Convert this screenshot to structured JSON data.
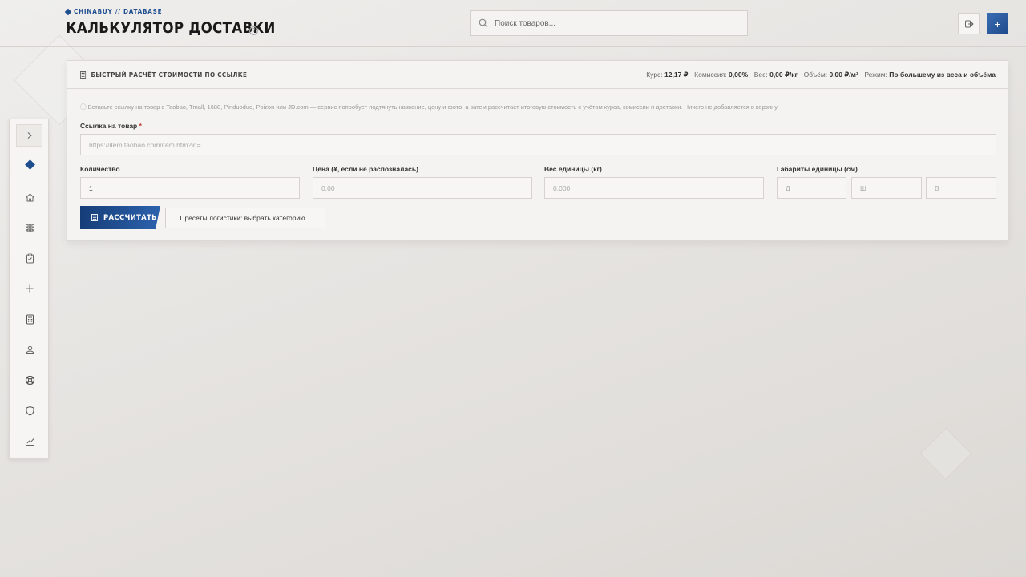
{
  "header": {
    "brand": "CHINABUY // DATABASE",
    "title": "КАЛЬКУЛЯТОР ДОСТАВКИ",
    "help_icon": "?",
    "search_placeholder": "Поиск товаров...",
    "plus_label": "+"
  },
  "sidebar": {
    "items": [
      "chevron-right-icon",
      "diamond-icon",
      "home-icon",
      "grid-icon",
      "clipboard-check-icon",
      "plus-icon",
      "calculator-icon",
      "user-icon",
      "lifebuoy-icon",
      "shield-icon",
      "chart-line-icon"
    ]
  },
  "card": {
    "title": "БЫСТРЫЙ РАСЧЁТ СТОИМОСТИ ПО ССЫЛКЕ",
    "stats": {
      "rate_label": "Курс:",
      "rate_value": "12,17 ₽",
      "commission_label": "· Комиссия:",
      "commission_value": "0,00%",
      "weight_label": "· Вес:",
      "weight_value": "0,00 ₽/кг",
      "volume_label": "· Объём:",
      "volume_value": "0,00 ₽/м³",
      "mode_label": "· Режим:",
      "mode_value": "По большему из веса и объёма"
    },
    "hint": "ⓘ Вставьте ссылку на товар с Taobao, Tmall, 1688, Pinduoduo, Poizon или JD.com — сервис попробует подтянуть название, цену и фото, а затем рассчитает итоговую стоимость с учётом курса, комиссии и доставки. Ничего не добавляется в корзину.",
    "link_label": "Ссылка на товар",
    "link_required": "*",
    "link_placeholder": "https://item.taobao.com/item.htm?id=...",
    "qty_label": "Количество",
    "qty_value": "1",
    "price_label": "Цена (¥, если не распозналась)",
    "price_placeholder": "0.00",
    "weight_label": "Вес единицы (кг)",
    "weight_placeholder": "0.000",
    "dims_label": "Габариты единицы (см)",
    "dim_l_placeholder": "Д",
    "dim_w_placeholder": "Ш",
    "dim_h_placeholder": "В",
    "calc_button": "РАССЧИТАТЬ",
    "presets_button": "Пресеты логистики: выбрать категорию..."
  }
}
